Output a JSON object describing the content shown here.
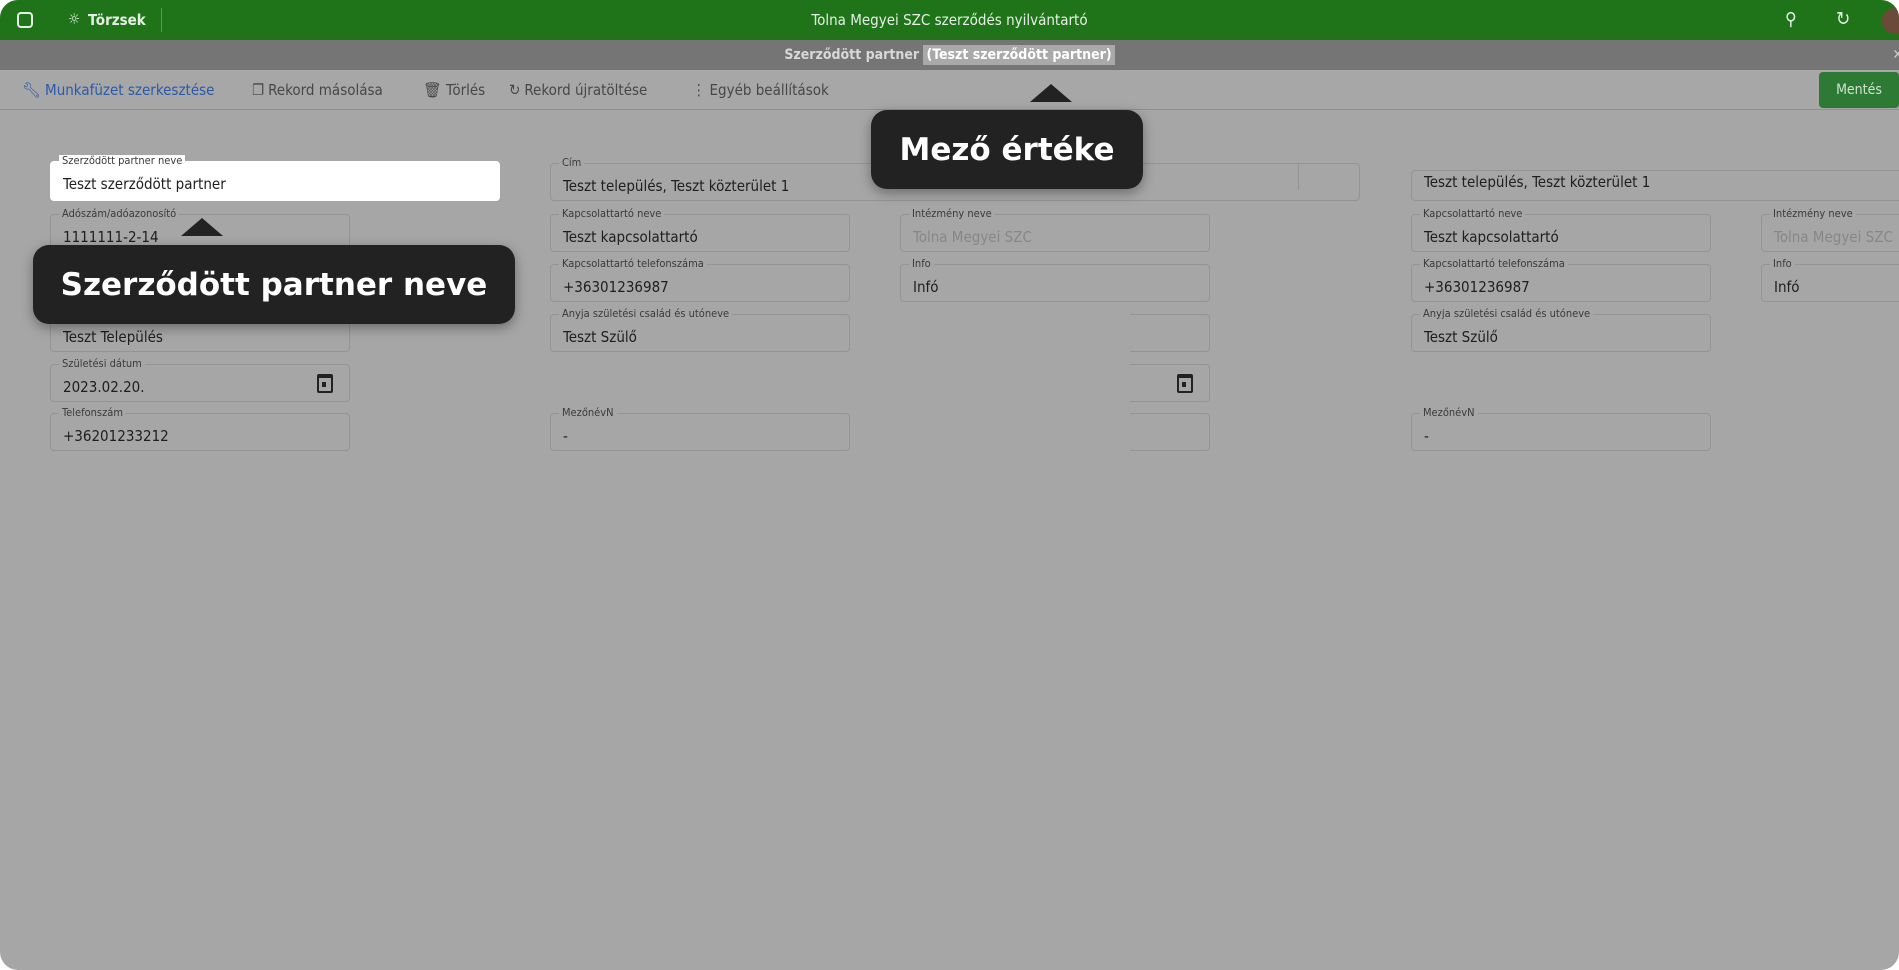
{
  "topbar": {
    "title": "Tolna Megyei SZC szerződés nyilvántartó",
    "nav_label": "Törzsek",
    "color": "#1f741a"
  },
  "subheader": {
    "entity": "Szerződött partner",
    "record": "(Teszt szerződött partner)"
  },
  "toolbar": {
    "edit": "Munkafüzet szerkesztése",
    "copy": "Rekord másolása",
    "delete": "Törlés",
    "reload": "Rekord újratöltése",
    "more": "Egyéb beállítások",
    "save": "Mentés"
  },
  "fields": {
    "partner_name": {
      "label": "Szerződött partner neve",
      "value": "Teszt szerződött partner"
    },
    "tax": {
      "label": "Adószám/adóazonosító",
      "value": "1111111-2-14"
    },
    "town": {
      "value": "Teszt Település"
    },
    "birth": {
      "label": "Születési dátum",
      "value": "2023.02.20."
    },
    "phone": {
      "label": "Telefonszám",
      "value": "+36201233212"
    },
    "address": {
      "label": "Cím",
      "value": "Teszt település, Teszt közterület 1"
    },
    "contact": {
      "label": "Kapcsolattartó neve",
      "value": "Teszt kapcsolattartó"
    },
    "contact_phone": {
      "label": "Kapcsolattartó telefonszáma",
      "value": "+36301236987"
    },
    "mother": {
      "label": "Anyja születési család és utóneve",
      "value": "Teszt Szülő"
    },
    "mezo": {
      "label": "MezőnévN",
      "value": "-"
    },
    "inst": {
      "label": "Intézmény neve",
      "value": "Tolna Megyei SZC"
    },
    "info": {
      "label": "Info",
      "value": "Infó"
    }
  },
  "tooltips": {
    "value": "Mező értéke",
    "name": "Szerződött partner neve"
  }
}
